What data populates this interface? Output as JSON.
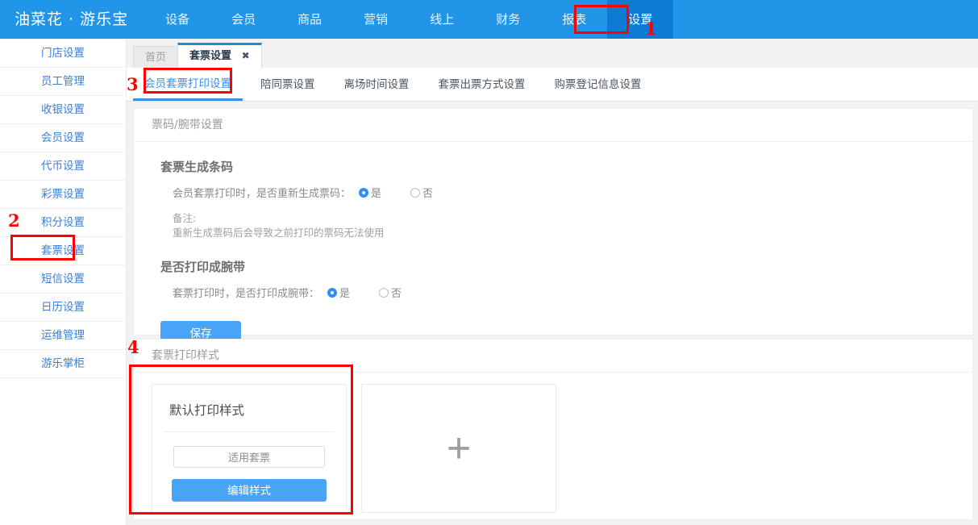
{
  "topnav": {
    "brand": "油菜花 · 游乐宝",
    "active_color": "#0d7ad4",
    "bar_color": "#2196e8",
    "items": [
      {
        "label": "设备",
        "active": false
      },
      {
        "label": "会员",
        "active": false
      },
      {
        "label": "商品",
        "active": false
      },
      {
        "label": "营销",
        "active": false
      },
      {
        "label": "线上",
        "active": false
      },
      {
        "label": "财务",
        "active": false
      },
      {
        "label": "报表",
        "active": false
      },
      {
        "label": "设置",
        "active": true
      }
    ]
  },
  "sidebar": {
    "items": [
      {
        "label": "门店设置"
      },
      {
        "label": "员工管理"
      },
      {
        "label": "收银设置"
      },
      {
        "label": "会员设置"
      },
      {
        "label": "代币设置"
      },
      {
        "label": "彩票设置"
      },
      {
        "label": "积分设置"
      },
      {
        "label": "套票设置"
      },
      {
        "label": "短信设置"
      },
      {
        "label": "日历设置"
      },
      {
        "label": "运维管理"
      },
      {
        "label": "游乐掌柜"
      }
    ]
  },
  "page_tabs": [
    {
      "label": "首页",
      "active": false,
      "closable": false
    },
    {
      "label": "套票设置",
      "active": true,
      "closable": true,
      "close_glyph": "✖"
    }
  ],
  "sub_tabs": [
    {
      "label": "会员套票打印设置",
      "active": true
    },
    {
      "label": "陪同票设置",
      "active": false
    },
    {
      "label": "离场时间设置",
      "active": false
    },
    {
      "label": "套票出票方式设置",
      "active": false
    },
    {
      "label": "购票登记信息设置",
      "active": false
    }
  ],
  "ticket_code_card": {
    "header": "票码/腕带设置",
    "section_barcode": {
      "title": "套票生成条码",
      "question": "会员套票打印时，是否重新生成票码：",
      "option_yes": "是",
      "option_no": "否",
      "selected": "是",
      "note_label": "备注:",
      "note_text": "重新生成票码后会导致之前打印的票码无法使用"
    },
    "section_wristband": {
      "title": "是否打印成腕带",
      "question": "套票打印时，是否打印成腕带：",
      "option_yes": "是",
      "option_no": "否",
      "selected": "是"
    },
    "save_label": "保存"
  },
  "print_style_card": {
    "header": "套票打印样式",
    "styles": [
      {
        "title": "默认打印样式",
        "apply_label": "适用套票",
        "edit_label": "编辑样式"
      }
    ],
    "add_glyph": "+"
  },
  "annotations": [
    {
      "num": "1"
    },
    {
      "num": "2"
    },
    {
      "num": "3"
    },
    {
      "num": "4"
    }
  ],
  "colors": {
    "nav_blue": "#2196e8",
    "nav_active_blue": "#0d7ad4",
    "link_blue": "#3b7fd4",
    "primary_blue": "#49a4f7",
    "accent_blue": "#3a8ee6",
    "annotation_red": "#ff0000"
  }
}
